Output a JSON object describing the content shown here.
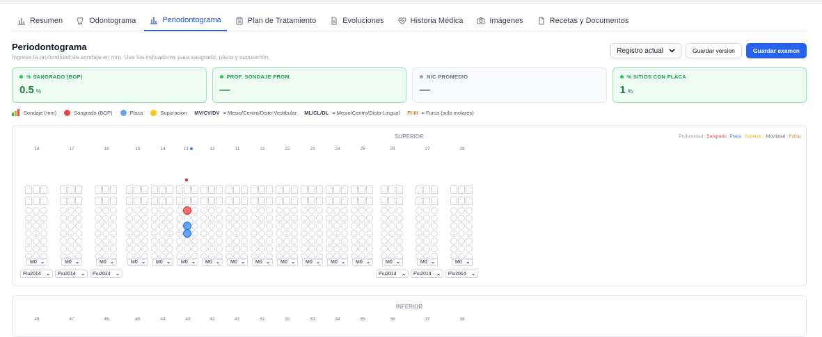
{
  "tabs": [
    {
      "label": "Resumen",
      "icon": "bar-chart-icon"
    },
    {
      "label": "Odontograma",
      "icon": "tooth-icon"
    },
    {
      "label": "Periodontograma",
      "icon": "bar-chart-icon",
      "active": true
    },
    {
      "label": "Plan de Tratamiento",
      "icon": "clipboard-icon"
    },
    {
      "label": "Evoluciones",
      "icon": "document-icon"
    },
    {
      "label": "Historia Médica",
      "icon": "heart-icon"
    },
    {
      "label": "Imágenes",
      "icon": "camera-icon"
    },
    {
      "label": "Recetas y Documentos",
      "icon": "file-icon"
    }
  ],
  "header": {
    "title": "Periodontograma",
    "subtitle": "Ingrese la profundidad de sondaje en mm. Use los indicadores para sangrado, placa y supuración."
  },
  "actions": {
    "registro_select": "Registro actual",
    "save_version": "Guardar version",
    "save_exam": "Guardar examen"
  },
  "cards": [
    {
      "label": "% SANGRADO (BOP)",
      "value": "0.5",
      "unit": "%",
      "color": "#22c55e"
    },
    {
      "label": "PROF. SONDAJE PROM.",
      "value": "—",
      "unit": "",
      "color": "#22c55e"
    },
    {
      "label": "NIC PROMEDIO",
      "value": "—",
      "unit": "",
      "color": "#9ca3af"
    },
    {
      "label": "% SITIOS CON PLACA",
      "value": "1",
      "unit": "%",
      "color": "#22c55e"
    }
  ],
  "legend": {
    "sondaje": "Sondaje (mm)",
    "sangrado": "Sangrado (BOP)",
    "placa": "Placa",
    "supuracion": "Supuracion",
    "mv_key": "MV/CV/DV",
    "mv_desc": "= Mesio/Centro/Disto-Vestibular",
    "ml_key": "ML/CL/DL",
    "ml_desc": "= Mesio/Centro/Disto-Lingual",
    "f_key": "FI-III",
    "f_desc": "= Furca (solo molares)",
    "colors": {
      "sangrado": "#ef4444",
      "placa": "#60a5fa",
      "supuracion": "#facc15"
    }
  },
  "panel_legend": [
    {
      "label": "Profundidad",
      "color": "#9ca3af"
    },
    {
      "label": "Sangrado",
      "color": "#ef4444"
    },
    {
      "label": "Placa",
      "color": "#3b82f6"
    },
    {
      "label": "Supurac.",
      "color": "#eab308"
    },
    {
      "label": "Movilidad",
      "color": "#6b7280"
    },
    {
      "label": "Furca",
      "color": "#f97316"
    }
  ],
  "superior": {
    "title": "SUPERIOR",
    "teeth": [
      "18",
      "17",
      "16",
      "15",
      "14",
      "13",
      "12",
      "11",
      "21",
      "22",
      "23",
      "24",
      "25",
      "26",
      "27",
      "28"
    ],
    "mobility": "M0",
    "furca": "F\\u2014"
  },
  "inferior": {
    "title": "INFERIOR",
    "teeth": [
      "48",
      "47",
      "46",
      "45",
      "44",
      "43",
      "42",
      "41",
      "31",
      "32",
      "33",
      "34",
      "35",
      "36",
      "37",
      "38"
    ]
  }
}
